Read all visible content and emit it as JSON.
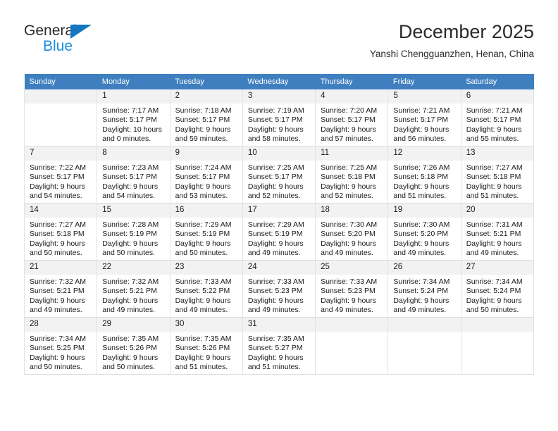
{
  "brand": {
    "name_top": "General",
    "name_bottom": "Blue",
    "triangle_color": "#1577c1",
    "blue_color": "#1a8fe0"
  },
  "header": {
    "month_title": "December 2025",
    "location": "Yanshi Chengguanzhen, Henan, China"
  },
  "calendar": {
    "header_bg": "#3f7fbf",
    "daynum_bg": "#f2f2f2",
    "weekday_headers": [
      "Sunday",
      "Monday",
      "Tuesday",
      "Wednesday",
      "Thursday",
      "Friday",
      "Saturday"
    ],
    "weeks": [
      [
        {
          "day": "",
          "sunrise": "",
          "sunset": "",
          "daylight_line1": "",
          "daylight_line2": ""
        },
        {
          "day": "1",
          "sunrise": "Sunrise: 7:17 AM",
          "sunset": "Sunset: 5:17 PM",
          "daylight_line1": "Daylight: 10 hours",
          "daylight_line2": "and 0 minutes."
        },
        {
          "day": "2",
          "sunrise": "Sunrise: 7:18 AM",
          "sunset": "Sunset: 5:17 PM",
          "daylight_line1": "Daylight: 9 hours",
          "daylight_line2": "and 59 minutes."
        },
        {
          "day": "3",
          "sunrise": "Sunrise: 7:19 AM",
          "sunset": "Sunset: 5:17 PM",
          "daylight_line1": "Daylight: 9 hours",
          "daylight_line2": "and 58 minutes."
        },
        {
          "day": "4",
          "sunrise": "Sunrise: 7:20 AM",
          "sunset": "Sunset: 5:17 PM",
          "daylight_line1": "Daylight: 9 hours",
          "daylight_line2": "and 57 minutes."
        },
        {
          "day": "5",
          "sunrise": "Sunrise: 7:21 AM",
          "sunset": "Sunset: 5:17 PM",
          "daylight_line1": "Daylight: 9 hours",
          "daylight_line2": "and 56 minutes."
        },
        {
          "day": "6",
          "sunrise": "Sunrise: 7:21 AM",
          "sunset": "Sunset: 5:17 PM",
          "daylight_line1": "Daylight: 9 hours",
          "daylight_line2": "and 55 minutes."
        }
      ],
      [
        {
          "day": "7",
          "sunrise": "Sunrise: 7:22 AM",
          "sunset": "Sunset: 5:17 PM",
          "daylight_line1": "Daylight: 9 hours",
          "daylight_line2": "and 54 minutes."
        },
        {
          "day": "8",
          "sunrise": "Sunrise: 7:23 AM",
          "sunset": "Sunset: 5:17 PM",
          "daylight_line1": "Daylight: 9 hours",
          "daylight_line2": "and 54 minutes."
        },
        {
          "day": "9",
          "sunrise": "Sunrise: 7:24 AM",
          "sunset": "Sunset: 5:17 PM",
          "daylight_line1": "Daylight: 9 hours",
          "daylight_line2": "and 53 minutes."
        },
        {
          "day": "10",
          "sunrise": "Sunrise: 7:25 AM",
          "sunset": "Sunset: 5:17 PM",
          "daylight_line1": "Daylight: 9 hours",
          "daylight_line2": "and 52 minutes."
        },
        {
          "day": "11",
          "sunrise": "Sunrise: 7:25 AM",
          "sunset": "Sunset: 5:18 PM",
          "daylight_line1": "Daylight: 9 hours",
          "daylight_line2": "and 52 minutes."
        },
        {
          "day": "12",
          "sunrise": "Sunrise: 7:26 AM",
          "sunset": "Sunset: 5:18 PM",
          "daylight_line1": "Daylight: 9 hours",
          "daylight_line2": "and 51 minutes."
        },
        {
          "day": "13",
          "sunrise": "Sunrise: 7:27 AM",
          "sunset": "Sunset: 5:18 PM",
          "daylight_line1": "Daylight: 9 hours",
          "daylight_line2": "and 51 minutes."
        }
      ],
      [
        {
          "day": "14",
          "sunrise": "Sunrise: 7:27 AM",
          "sunset": "Sunset: 5:18 PM",
          "daylight_line1": "Daylight: 9 hours",
          "daylight_line2": "and 50 minutes."
        },
        {
          "day": "15",
          "sunrise": "Sunrise: 7:28 AM",
          "sunset": "Sunset: 5:19 PM",
          "daylight_line1": "Daylight: 9 hours",
          "daylight_line2": "and 50 minutes."
        },
        {
          "day": "16",
          "sunrise": "Sunrise: 7:29 AM",
          "sunset": "Sunset: 5:19 PM",
          "daylight_line1": "Daylight: 9 hours",
          "daylight_line2": "and 50 minutes."
        },
        {
          "day": "17",
          "sunrise": "Sunrise: 7:29 AM",
          "sunset": "Sunset: 5:19 PM",
          "daylight_line1": "Daylight: 9 hours",
          "daylight_line2": "and 49 minutes."
        },
        {
          "day": "18",
          "sunrise": "Sunrise: 7:30 AM",
          "sunset": "Sunset: 5:20 PM",
          "daylight_line1": "Daylight: 9 hours",
          "daylight_line2": "and 49 minutes."
        },
        {
          "day": "19",
          "sunrise": "Sunrise: 7:30 AM",
          "sunset": "Sunset: 5:20 PM",
          "daylight_line1": "Daylight: 9 hours",
          "daylight_line2": "and 49 minutes."
        },
        {
          "day": "20",
          "sunrise": "Sunrise: 7:31 AM",
          "sunset": "Sunset: 5:21 PM",
          "daylight_line1": "Daylight: 9 hours",
          "daylight_line2": "and 49 minutes."
        }
      ],
      [
        {
          "day": "21",
          "sunrise": "Sunrise: 7:32 AM",
          "sunset": "Sunset: 5:21 PM",
          "daylight_line1": "Daylight: 9 hours",
          "daylight_line2": "and 49 minutes."
        },
        {
          "day": "22",
          "sunrise": "Sunrise: 7:32 AM",
          "sunset": "Sunset: 5:21 PM",
          "daylight_line1": "Daylight: 9 hours",
          "daylight_line2": "and 49 minutes."
        },
        {
          "day": "23",
          "sunrise": "Sunrise: 7:33 AM",
          "sunset": "Sunset: 5:22 PM",
          "daylight_line1": "Daylight: 9 hours",
          "daylight_line2": "and 49 minutes."
        },
        {
          "day": "24",
          "sunrise": "Sunrise: 7:33 AM",
          "sunset": "Sunset: 5:23 PM",
          "daylight_line1": "Daylight: 9 hours",
          "daylight_line2": "and 49 minutes."
        },
        {
          "day": "25",
          "sunrise": "Sunrise: 7:33 AM",
          "sunset": "Sunset: 5:23 PM",
          "daylight_line1": "Daylight: 9 hours",
          "daylight_line2": "and 49 minutes."
        },
        {
          "day": "26",
          "sunrise": "Sunrise: 7:34 AM",
          "sunset": "Sunset: 5:24 PM",
          "daylight_line1": "Daylight: 9 hours",
          "daylight_line2": "and 49 minutes."
        },
        {
          "day": "27",
          "sunrise": "Sunrise: 7:34 AM",
          "sunset": "Sunset: 5:24 PM",
          "daylight_line1": "Daylight: 9 hours",
          "daylight_line2": "and 50 minutes."
        }
      ],
      [
        {
          "day": "28",
          "sunrise": "Sunrise: 7:34 AM",
          "sunset": "Sunset: 5:25 PM",
          "daylight_line1": "Daylight: 9 hours",
          "daylight_line2": "and 50 minutes."
        },
        {
          "day": "29",
          "sunrise": "Sunrise: 7:35 AM",
          "sunset": "Sunset: 5:26 PM",
          "daylight_line1": "Daylight: 9 hours",
          "daylight_line2": "and 50 minutes."
        },
        {
          "day": "30",
          "sunrise": "Sunrise: 7:35 AM",
          "sunset": "Sunset: 5:26 PM",
          "daylight_line1": "Daylight: 9 hours",
          "daylight_line2": "and 51 minutes."
        },
        {
          "day": "31",
          "sunrise": "Sunrise: 7:35 AM",
          "sunset": "Sunset: 5:27 PM",
          "daylight_line1": "Daylight: 9 hours",
          "daylight_line2": "and 51 minutes."
        },
        {
          "day": "",
          "sunrise": "",
          "sunset": "",
          "daylight_line1": "",
          "daylight_line2": ""
        },
        {
          "day": "",
          "sunrise": "",
          "sunset": "",
          "daylight_line1": "",
          "daylight_line2": ""
        },
        {
          "day": "",
          "sunrise": "",
          "sunset": "",
          "daylight_line1": "",
          "daylight_line2": ""
        }
      ]
    ]
  }
}
